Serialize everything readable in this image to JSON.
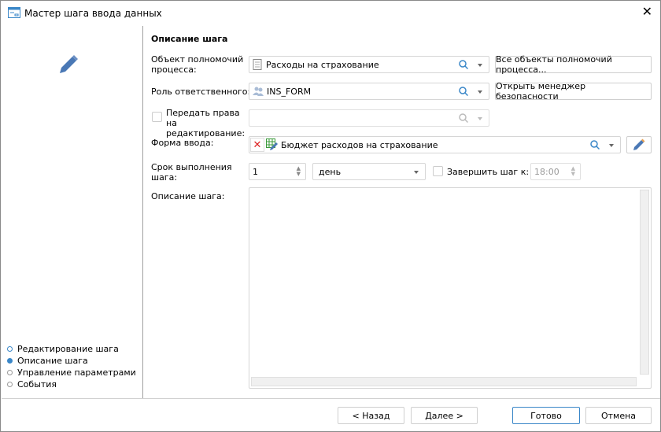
{
  "window": {
    "title": "Мастер шага ввода данных"
  },
  "section_title": "Описание шага",
  "fields": {
    "authority_object": {
      "label": "Объект полномочий процесса:",
      "value": "Расходы на страхование",
      "button": "Все объекты полномочий процесса..."
    },
    "role": {
      "label": "Роль ответственного:",
      "value": "INS_FORM",
      "button": "Открыть менеджер безопасности"
    },
    "transfer_rights": {
      "label": "Передать права на редактирование:",
      "checked": false,
      "value": ""
    },
    "input_form": {
      "label": "Форма ввода:",
      "value": "Бюджет расходов на страхование"
    },
    "deadline": {
      "label": "Срок выполнения шага:",
      "amount": "1",
      "unit": "день",
      "finish_label": "Завершить шаг к:",
      "finish_checked": false,
      "finish_time": "18:00"
    },
    "description": {
      "label": "Описание шага:",
      "value": ""
    }
  },
  "steps": [
    {
      "label": "Редактирование шага",
      "state": "done"
    },
    {
      "label": "Описание шага",
      "state": "current"
    },
    {
      "label": "Управление параметрами",
      "state": "pending"
    },
    {
      "label": "События",
      "state": "pending"
    }
  ],
  "footer": {
    "back": "< Назад",
    "next": "Далее >",
    "finish": "Готово",
    "cancel": "Отмена"
  },
  "colors": {
    "accent": "#3a87c8",
    "pencil": "#4a78b5"
  }
}
